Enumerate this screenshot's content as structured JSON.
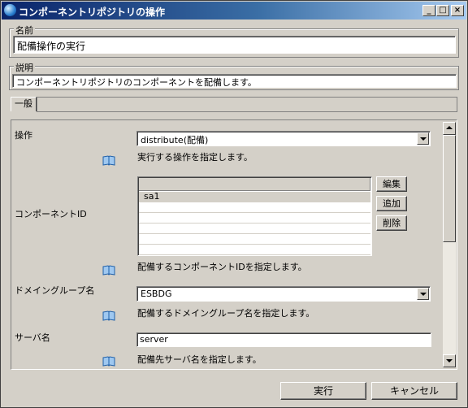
{
  "window": {
    "title": "コンポーネントリポジトリの操作",
    "minimize_glyph": "_",
    "maximize_glyph": "□",
    "close_glyph": "×"
  },
  "name_group": {
    "legend": "名前",
    "value": "配備操作の実行"
  },
  "desc_group": {
    "legend": "説明",
    "value": "コンポーネントリポジトリのコンポーネントを配備します。"
  },
  "tabs": [
    {
      "label": "一般",
      "selected": true
    }
  ],
  "form": {
    "operation": {
      "label": "操作",
      "value": "distribute(配備)",
      "help": "実行する操作を指定します。"
    },
    "component_id": {
      "label": "コンポーネントID",
      "rows": [
        "sa1",
        "",
        "",
        "",
        "",
        ""
      ],
      "selected_row": 0,
      "edit_label": "編集",
      "add_label": "追加",
      "delete_label": "削除",
      "help": "配備するコンポーネントIDを指定します。"
    },
    "domain_group": {
      "label": "ドメイングループ名",
      "value": "ESBDG",
      "help": "配備するドメイングループ名を指定します。"
    },
    "server": {
      "label": "サーバ名",
      "value": "server",
      "help": "配備先サーバ名を指定します。"
    }
  },
  "footer": {
    "execute_label": "実行",
    "cancel_label": "キャンセル"
  }
}
